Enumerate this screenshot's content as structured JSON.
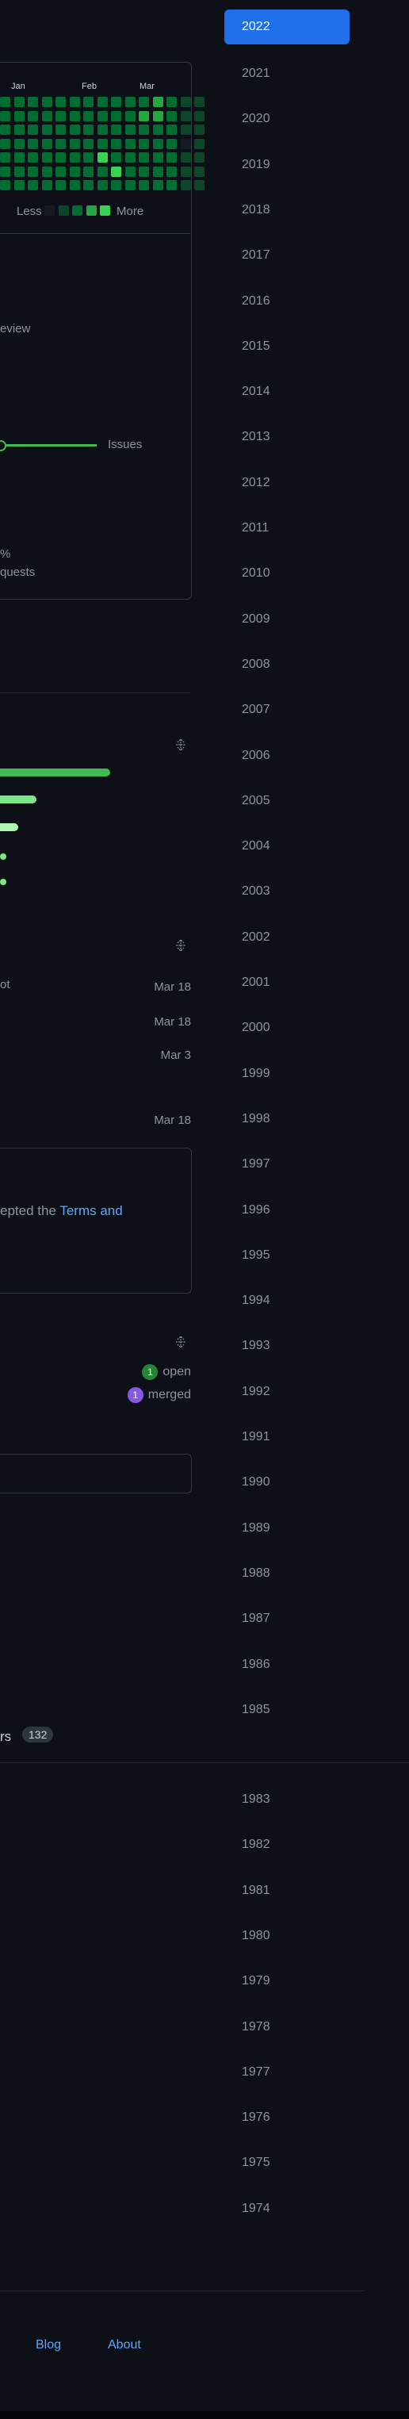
{
  "years": {
    "selected": "2022",
    "list": [
      "2021",
      "2020",
      "2019",
      "2018",
      "2017",
      "2016",
      "2015",
      "2014",
      "2013",
      "2012",
      "2011",
      "2010",
      "2009",
      "2008",
      "2007",
      "2006",
      "2005",
      "2004",
      "2003",
      "2002",
      "2001",
      "2000",
      "1999",
      "1998",
      "1997",
      "1996",
      "1995",
      "1994",
      "1993",
      "1992",
      "1991",
      "1990",
      "1989",
      "1988",
      "1987",
      "1986",
      "1985"
    ],
    "list_lower": [
      "1983",
      "1982",
      "1981",
      "1980",
      "1979",
      "1978",
      "1977",
      "1976",
      "1975",
      "1974"
    ]
  },
  "heatmap": {
    "months": [
      "Jan",
      "Feb",
      "Mar"
    ],
    "legend_less": "Less",
    "legend_more": "More",
    "colors": [
      "#161b22",
      "#0e4429",
      "#006d32",
      "#26a641",
      "#39d353"
    ]
  },
  "activity": {
    "review_label": "eview",
    "issues_label": "Issues",
    "percent_label": "%",
    "requests_label": "quests"
  },
  "languages": {
    "bars": [
      {
        "fraction": 0.62,
        "color": "#3fb950"
      },
      {
        "fraction": 0.22,
        "color": "#7ee787"
      },
      {
        "fraction": 0.12,
        "color": "#aff5b4"
      }
    ]
  },
  "repos": {
    "fragment": "ot",
    "dates": [
      "Mar 18",
      "Mar 18",
      "Mar 3",
      "Mar 18"
    ]
  },
  "terms": {
    "text_before": "epted the ",
    "link_text": "Terms and"
  },
  "prs": {
    "open_count": "1",
    "open_label": "open",
    "merged_count": "1",
    "merged_label": "merged"
  },
  "stars": {
    "label_fragment": "rs",
    "count": "132"
  },
  "footer": {
    "blog": "Blog",
    "about": "About"
  }
}
